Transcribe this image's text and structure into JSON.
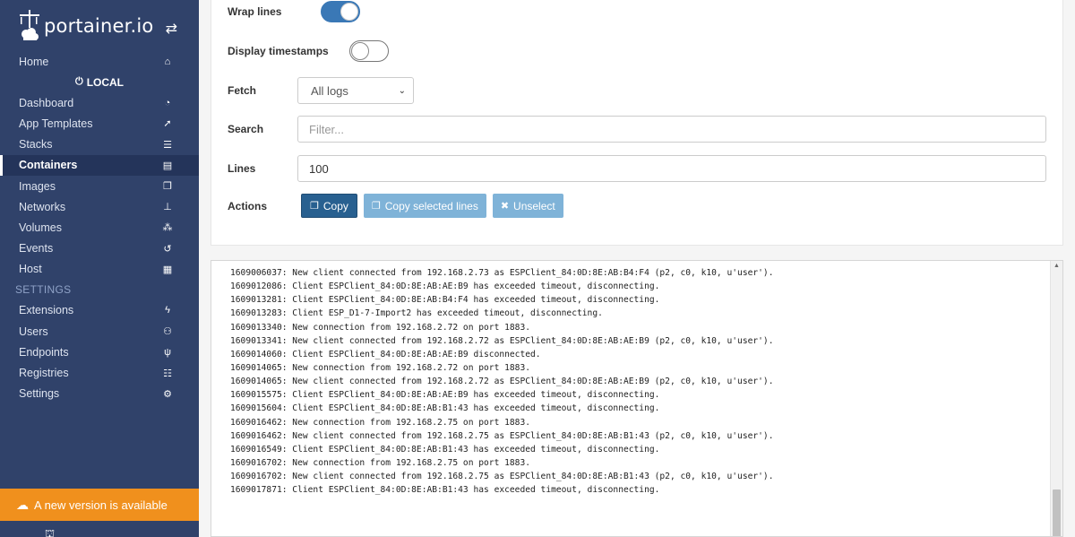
{
  "brand": {
    "name": "portainer.io",
    "toggle_icon": "swap-arrows-icon"
  },
  "sidebar": {
    "home": {
      "label": "Home",
      "icon": "home-icon"
    },
    "endpoint": "LOCAL",
    "items": [
      {
        "label": "Dashboard",
        "icon": "tachometer-icon",
        "active": false
      },
      {
        "label": "App Templates",
        "icon": "rocket-icon",
        "active": false
      },
      {
        "label": "Stacks",
        "icon": "list-icon",
        "active": false
      },
      {
        "label": "Containers",
        "icon": "server-icon",
        "active": true
      },
      {
        "label": "Images",
        "icon": "clone-icon",
        "active": false
      },
      {
        "label": "Networks",
        "icon": "sitemap-icon",
        "active": false
      },
      {
        "label": "Volumes",
        "icon": "cubes-icon",
        "active": false
      },
      {
        "label": "Events",
        "icon": "history-icon",
        "active": false
      },
      {
        "label": "Host",
        "icon": "th-icon",
        "active": false
      }
    ],
    "settings_title": "SETTINGS",
    "settings_items": [
      {
        "label": "Extensions",
        "icon": "bolt-icon"
      },
      {
        "label": "Users",
        "icon": "users-icon"
      },
      {
        "label": "Endpoints",
        "icon": "plug-icon"
      },
      {
        "label": "Registries",
        "icon": "database-icon"
      },
      {
        "label": "Settings",
        "icon": "cogs-icon"
      }
    ],
    "update_banner": "A new version is available"
  },
  "form": {
    "wrap_lines": {
      "label": "Wrap lines",
      "on": true
    },
    "display_timestamps": {
      "label": "Display timestamps",
      "on": false
    },
    "fetch": {
      "label": "Fetch",
      "value": "All logs"
    },
    "search": {
      "label": "Search",
      "placeholder": "Filter..."
    },
    "lines": {
      "label": "Lines",
      "value": "100"
    },
    "actions": {
      "label": "Actions",
      "copy": "Copy",
      "copy_selected": "Copy selected lines",
      "unselect": "Unselect"
    }
  },
  "logs": [
    "1609006037: New client connected from 192.168.2.73 as ESPClient_84:0D:8E:AB:B4:F4 (p2, c0, k10, u'user').",
    "1609012086: Client ESPClient_84:0D:8E:AB:AE:B9 has exceeded timeout, disconnecting.",
    "1609013281: Client ESPClient_84:0D:8E:AB:B4:F4 has exceeded timeout, disconnecting.",
    "1609013283: Client ESP_D1-7-Import2 has exceeded timeout, disconnecting.",
    "1609013340: New connection from 192.168.2.72 on port 1883.",
    "1609013341: New client connected from 192.168.2.72 as ESPClient_84:0D:8E:AB:AE:B9 (p2, c0, k10, u'user').",
    "1609014060: Client ESPClient_84:0D:8E:AB:AE:B9 disconnected.",
    "1609014065: New connection from 192.168.2.72 on port 1883.",
    "1609014065: New client connected from 192.168.2.72 as ESPClient_84:0D:8E:AB:AE:B9 (p2, c0, k10, u'user').",
    "1609015575: Client ESPClient_84:0D:8E:AB:AE:B9 has exceeded timeout, disconnecting.",
    "1609015604: Client ESPClient_84:0D:8E:AB:B1:43 has exceeded timeout, disconnecting.",
    "1609016462: New connection from 192.168.2.75 on port 1883.",
    "1609016462: New client connected from 192.168.2.75 as ESPClient_84:0D:8E:AB:B1:43 (p2, c0, k10, u'user').",
    "1609016549: Client ESPClient_84:0D:8E:AB:B1:43 has exceeded timeout, disconnecting.",
    "1609016702: New connection from 192.168.2.75 on port 1883.",
    "1609016702: New client connected from 192.168.2.75 as ESPClient_84:0D:8E:AB:B1:43 (p2, c0, k10, u'user').",
    "1609017871: Client ESPClient_84:0D:8E:AB:B1:43 has exceeded timeout, disconnecting."
  ]
}
